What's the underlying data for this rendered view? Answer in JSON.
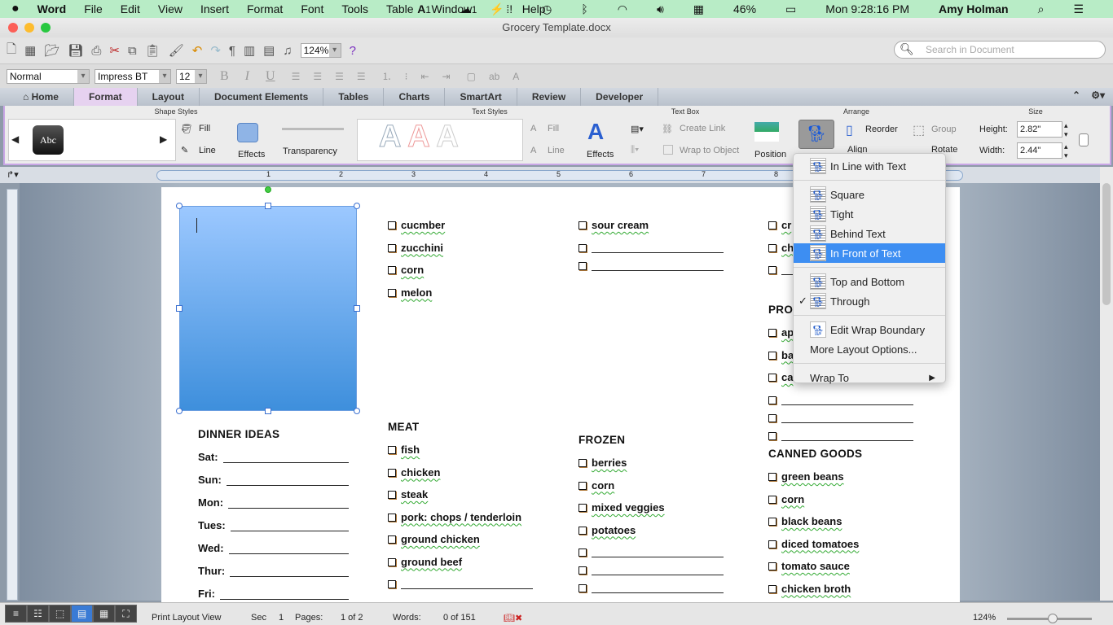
{
  "menubar": {
    "app": "Word",
    "items": [
      "File",
      "Edit",
      "View",
      "Insert",
      "Format",
      "Font",
      "Tools",
      "Table",
      "Window",
      "Help"
    ],
    "adobe_badge": "1",
    "cc_badge": "1",
    "battery": "46%",
    "clock": "Mon 9:28:16 PM",
    "user": "Amy Holman"
  },
  "window": {
    "title": "Grocery Template.docx"
  },
  "toolbar": {
    "zoom": "124%",
    "search_placeholder": "Search in Document",
    "style": "Normal",
    "font": "Impress BT",
    "size": "12"
  },
  "tabs": [
    "Home",
    "Format",
    "Layout",
    "Document Elements",
    "Tables",
    "Charts",
    "SmartArt",
    "Review",
    "Developer"
  ],
  "active_tab": "Format",
  "ribbon": {
    "shape_styles": {
      "title": "Shape Styles",
      "sample": "Abc",
      "fill": "Fill",
      "line": "Line",
      "effects": "Effects",
      "transparency": "Transparency"
    },
    "text_styles": {
      "title": "Text Styles",
      "fill": "Fill",
      "line": "Line",
      "effects": "Effects"
    },
    "text_box": {
      "title": "Text Box",
      "create_link": "Create Link",
      "wrap_to_object": "Wrap to Object"
    },
    "arrange": {
      "title": "Arrange",
      "position": "Position",
      "reorder": "Reorder",
      "group": "Group",
      "align": "Align",
      "rotate": "Rotate"
    },
    "size": {
      "title": "Size",
      "height_label": "Height:",
      "height": "2.82\"",
      "width_label": "Width:",
      "width": "2.44\""
    }
  },
  "ruler": {
    "labels": [
      "1",
      "2",
      "3",
      "4",
      "5",
      "6",
      "7",
      "8"
    ]
  },
  "wrap_menu": {
    "items": [
      "In Line with Text",
      "Square",
      "Tight",
      "Behind Text",
      "In Front of Text",
      "Top and Bottom",
      "Through",
      "Edit Wrap Boundary",
      "More Layout Options...",
      "Wrap To"
    ],
    "highlighted": "In Front of Text",
    "checked": "Through"
  },
  "document": {
    "dinner": {
      "title": "DINNER IDEAS",
      "days": [
        "Sat:",
        "Sun:",
        "Mon:",
        "Tues:",
        "Wed:",
        "Thur:",
        "Fri:"
      ]
    },
    "col2_top": [
      "cucmber",
      "zucchini",
      "corn",
      "melon"
    ],
    "meat": {
      "title": "MEAT",
      "items": [
        "fish",
        "chicken",
        "steak",
        "pork: chops / tenderloin",
        "ground chicken",
        "ground beef",
        ""
      ]
    },
    "col3_top": [
      "sour cream",
      "",
      ""
    ],
    "frozen": {
      "title": "FROZEN",
      "items": [
        "berries",
        "corn",
        "mixed veggies",
        "potatoes",
        "",
        "",
        ""
      ]
    },
    "col4_top": [
      "cr",
      "ch",
      ""
    ],
    "produce": {
      "title": "PRO",
      "items": [
        "ap",
        "ba",
        "ca",
        "",
        "",
        ""
      ]
    },
    "canned": {
      "title": "CANNED GOODS",
      "items": [
        "green beans",
        "corn",
        "black beans",
        "diced tomatoes",
        "tomato sauce",
        "chicken broth"
      ]
    }
  },
  "status": {
    "view": "Print Layout View",
    "sec_label": "Sec",
    "sec": "1",
    "pages_label": "Pages:",
    "pages": "1 of 2",
    "words_label": "Words:",
    "words": "0 of 151",
    "zoom": "124%"
  }
}
